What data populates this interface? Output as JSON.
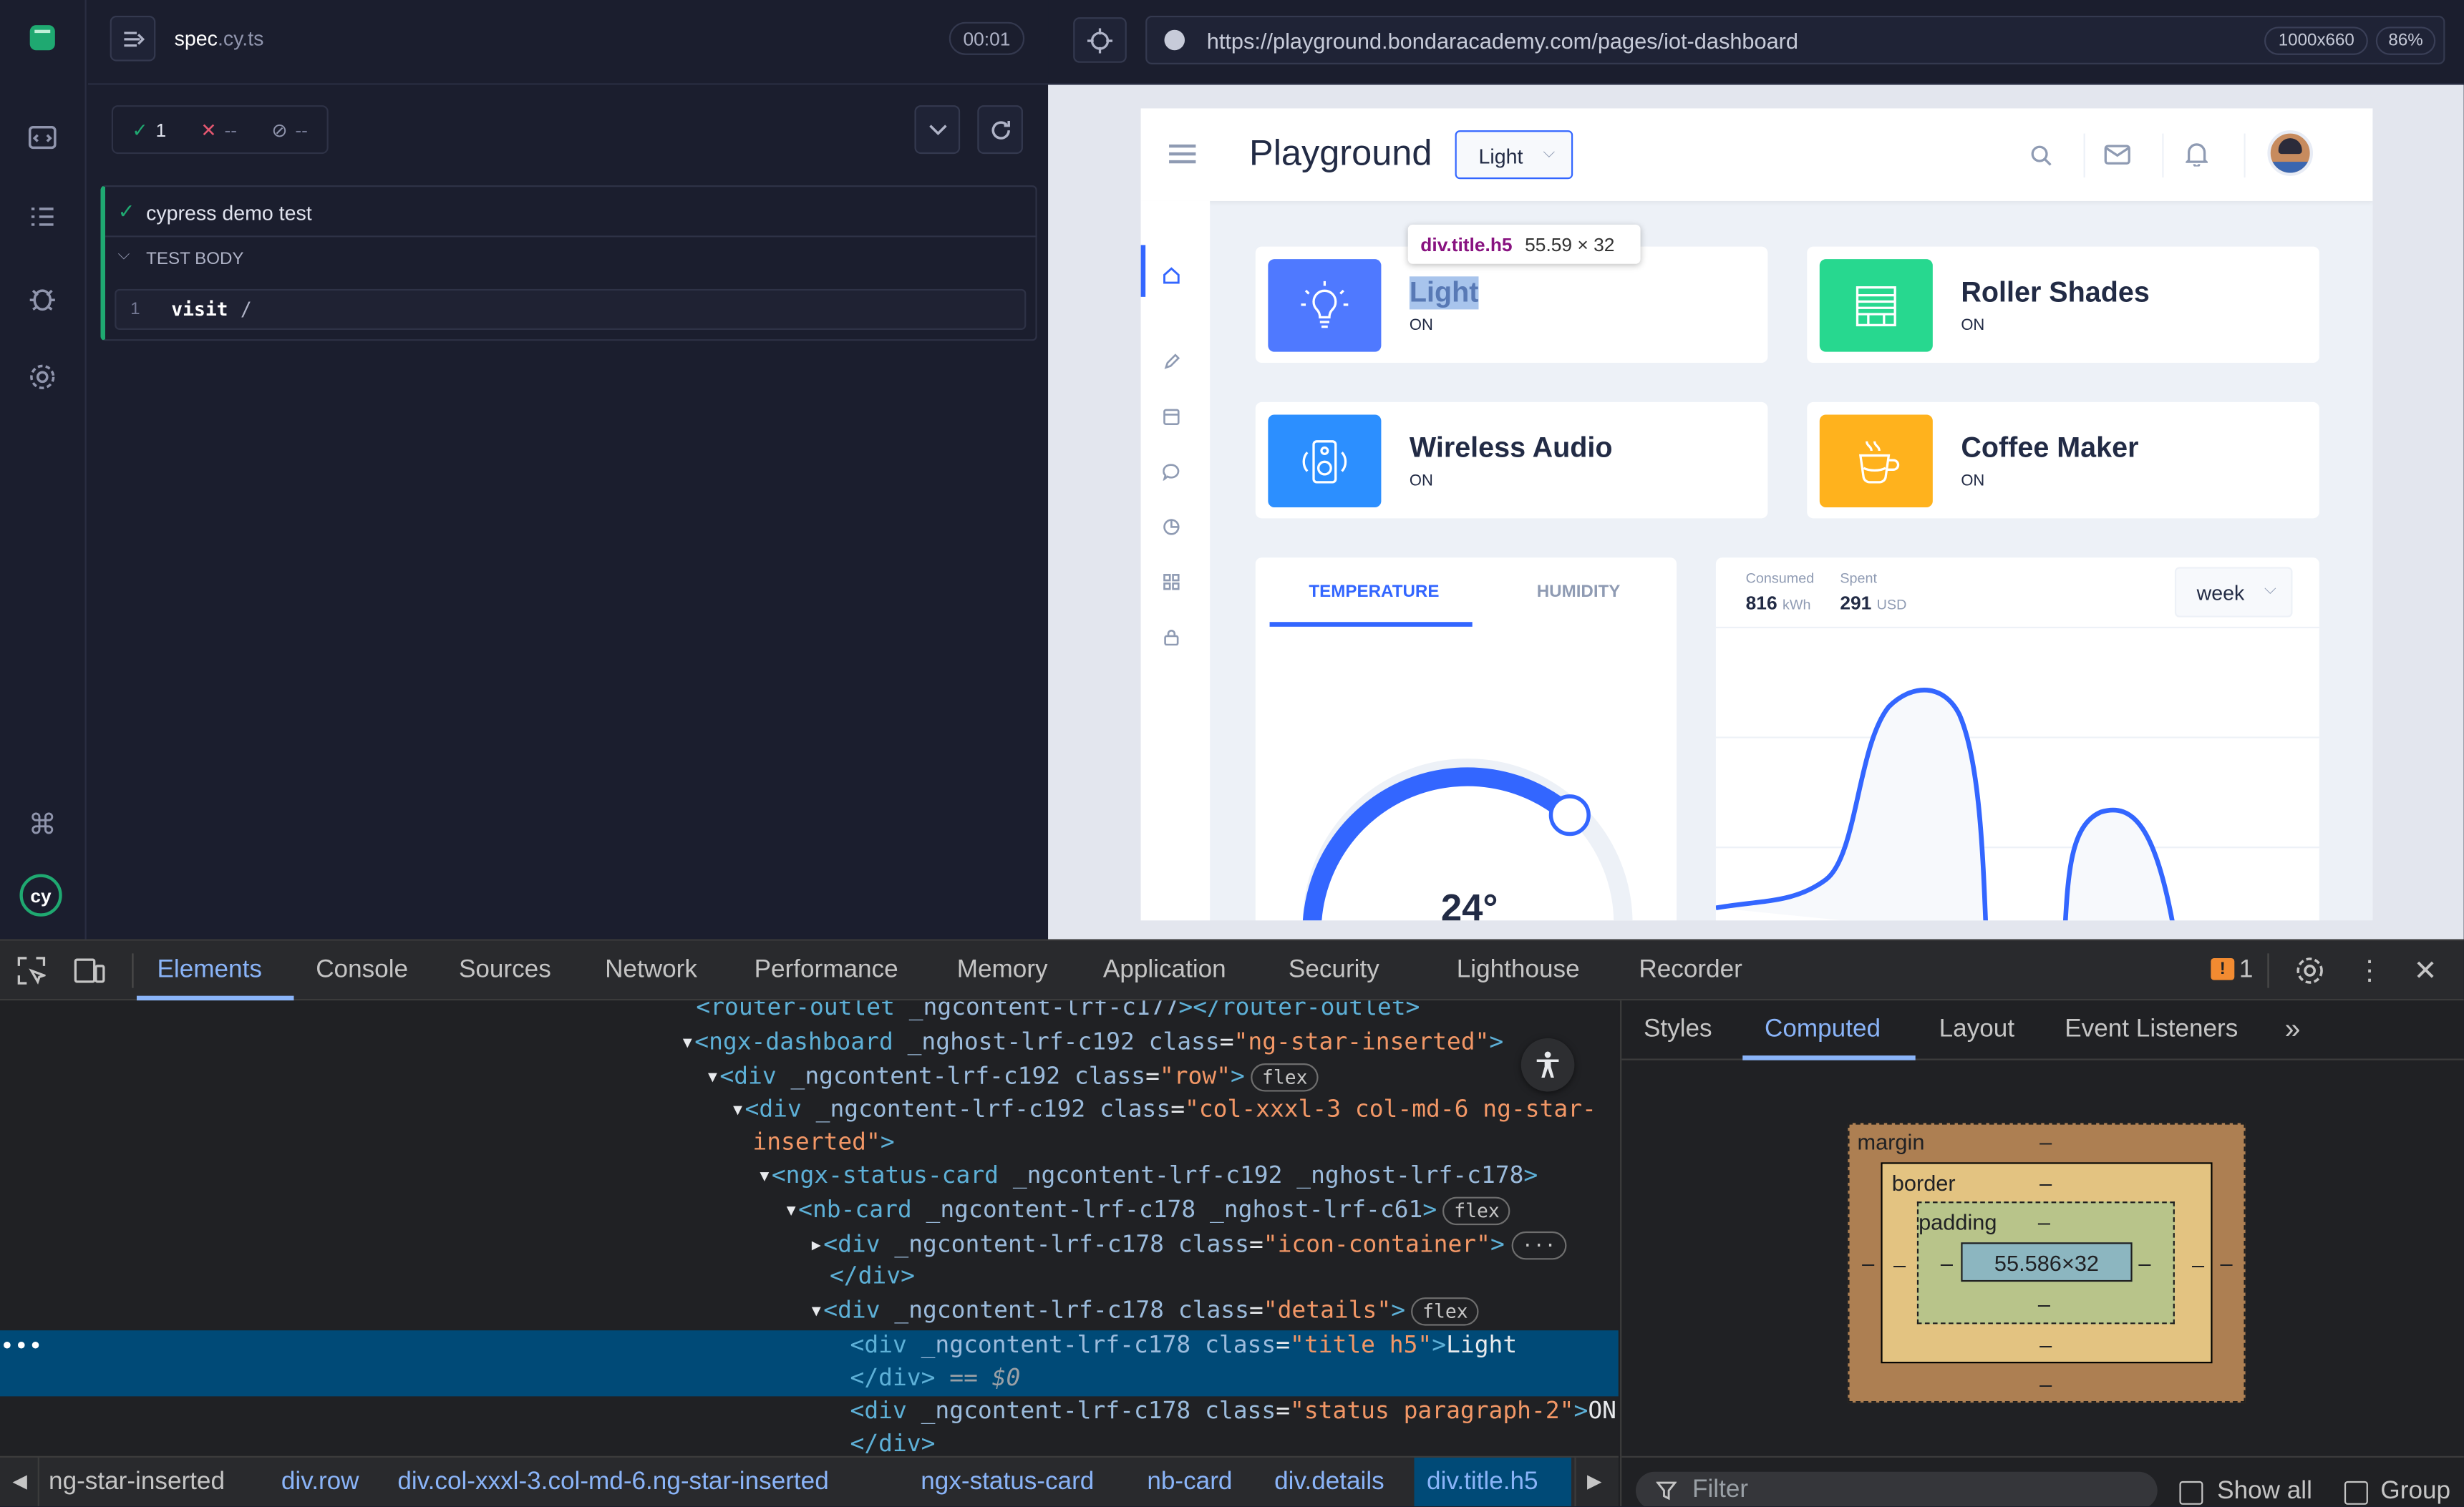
{
  "reporter": {
    "spec_name": "spec",
    "spec_ext": ".cy.ts",
    "timer": "00:01",
    "passed_count": "1",
    "failed_count": "--",
    "pending_count": "--",
    "test_title": "cypress demo test",
    "test_body_label": "TEST BODY",
    "command_index": "1",
    "command_name": "visit",
    "command_arg": "/"
  },
  "aut": {
    "url": "https://playground.bondaracademy.com/pages/iot-dashboard",
    "viewport": "1000x660",
    "scale": "86%"
  },
  "app": {
    "title": "Playground",
    "theme_select": "Light",
    "tooltip_selector": "div.title.h5",
    "tooltip_size": "55.59 × 32",
    "status_cards": [
      {
        "title": "Light",
        "status": "ON",
        "color": "#4f79ff",
        "icon": "bulb-icon"
      },
      {
        "title": "Roller Shades",
        "status": "ON",
        "color": "#27d88f",
        "icon": "shades-icon"
      },
      {
        "title": "Wireless Audio",
        "status": "ON",
        "color": "#2c8fff",
        "icon": "speaker-icon"
      },
      {
        "title": "Coffee Maker",
        "status": "ON",
        "color": "#ffb21d",
        "icon": "coffee-icon"
      }
    ],
    "temperature_tab": "TEMPERATURE",
    "humidity_tab": "HUMIDITY",
    "temperature_value": "24°",
    "consumed_label": "Consumed",
    "consumed_value": "816",
    "consumed_unit": "kWh",
    "spent_label": "Spent",
    "spent_value": "291",
    "spent_unit": "USD",
    "period_select": "week"
  },
  "devtools": {
    "tabs": [
      "Elements",
      "Console",
      "Sources",
      "Network",
      "Performance",
      "Memory",
      "Application",
      "Security",
      "Lighthouse",
      "Recorder"
    ],
    "issues_count": "1",
    "side_tabs": [
      "Styles",
      "Computed",
      "Layout",
      "Event Listeners"
    ],
    "dom_lines": [
      {
        "open": "",
        "tag": "router-outlet",
        "attrs": " _ngcontent-lrf-c177",
        "tail": "></router-outlet>"
      },
      {
        "tag": "ngx-dashboard",
        "attrs": " _nghost-lrf-c192 ",
        "attr_name": "class",
        "attr_val": "\"ng-star-inserted\"",
        "tail": ">"
      },
      {
        "tag": "div",
        "attrs": " _ngcontent-lrf-c192 ",
        "attr_name": "class",
        "attr_val": "\"row\"",
        "tail": ">",
        "pill": "flex"
      },
      {
        "tag": "div",
        "attrs": " _ngcontent-lrf-c192 ",
        "attr_name": "class",
        "attr_val": "\"col-xxxl-3 col-md-6 ng-star-",
        "tail": ""
      },
      {
        "cont": "inserted\"",
        "tail": ">"
      },
      {
        "tag": "ngx-status-card",
        "attrs": " _ngcontent-lrf-c192 _nghost-lrf-c178",
        "tail": ">"
      },
      {
        "tag": "nb-card",
        "attrs": " _ngcontent-lrf-c178 _nghost-lrf-c61",
        "tail": ">",
        "pill": "flex"
      },
      {
        "tag": "div",
        "attrs": " _ngcontent-lrf-c178 ",
        "attr_name": "class",
        "attr_val": "\"icon-container\"",
        "tail": ">",
        "pill": "···"
      },
      {
        "close": "</div>"
      },
      {
        "tag": "div",
        "attrs": " _ngcontent-lrf-c178 ",
        "attr_name": "class",
        "attr_val": "\"details\"",
        "tail": ">",
        "pill": "flex"
      },
      {
        "tag": "div",
        "attrs": " _ngcontent-lrf-c178 ",
        "attr_name": "class",
        "attr_val": "\"title h5\"",
        "tail": ">",
        "text": "Light"
      },
      {
        "close": "</div>",
        "suffix": " == $0"
      },
      {
        "tag": "div",
        "attrs": " _ngcontent-lrf-c178 ",
        "attr_name": "class",
        "attr_val": "\"status paragraph-2\"",
        "tail": ">",
        "text": "ON"
      },
      {
        "close": "</div>"
      }
    ],
    "breadcrumbs": [
      "ng-star-inserted",
      "div.row",
      "div.col-xxxl-3.col-md-6.ng-star-inserted",
      "ngx-status-card",
      "nb-card",
      "div.details",
      "div.title.h5"
    ],
    "box_model": {
      "margin_label": "margin",
      "border_label": "border",
      "padding_label": "padding",
      "content_size": "55.586×32",
      "dash": "–"
    },
    "filter_placeholder": "Filter",
    "show_all_label": "Show all",
    "group_label": "Group"
  }
}
